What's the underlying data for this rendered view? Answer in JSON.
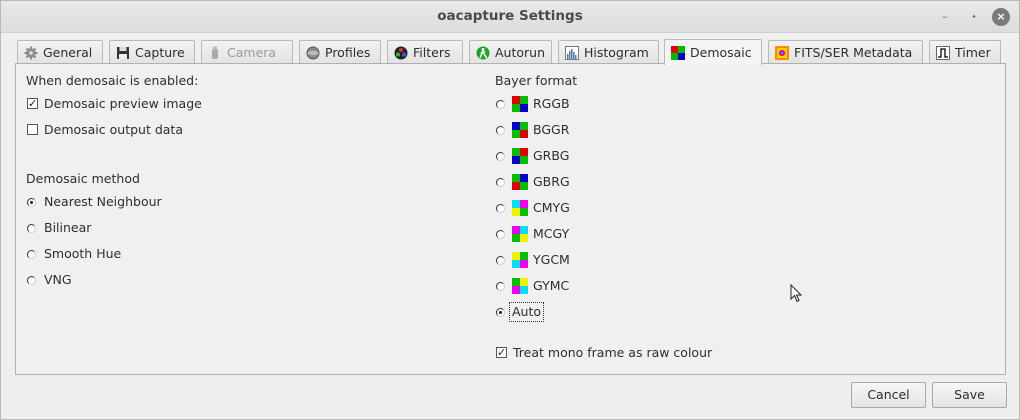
{
  "window": {
    "title": "oacapture Settings",
    "controls": {
      "minimize": "–",
      "maximize": "⬩",
      "close": "×"
    }
  },
  "tabs": [
    {
      "label": "General",
      "icon": "gear-icon"
    },
    {
      "label": "Capture",
      "icon": "floppy-disk-icon"
    },
    {
      "label": "Camera",
      "icon": "camera-icon",
      "disabled": true
    },
    {
      "label": "Profiles",
      "icon": "profiles-icon"
    },
    {
      "label": "Filters",
      "icon": "filter-wheel-icon"
    },
    {
      "label": "Autorun",
      "icon": "autorun-icon"
    },
    {
      "label": "Histogram",
      "icon": "histogram-icon"
    },
    {
      "label": "Demosaic",
      "icon": "demosaic-icon",
      "active": true
    },
    {
      "label": "FITS/SER Metadata",
      "icon": "metadata-icon"
    },
    {
      "label": "Timer",
      "icon": "timer-icon"
    }
  ],
  "demosaic": {
    "enabled_heading": "When demosaic is enabled:",
    "preview_label": "Demosaic preview image",
    "preview_checked": true,
    "output_label": "Demosaic output data",
    "output_checked": false,
    "method_heading": "Demosaic method",
    "methods": [
      {
        "label": "Nearest Neighbour",
        "selected": true
      },
      {
        "label": "Bilinear",
        "selected": false
      },
      {
        "label": "Smooth Hue",
        "selected": false
      },
      {
        "label": "VNG",
        "selected": false
      }
    ]
  },
  "bayer": {
    "heading": "Bayer format",
    "formats": [
      {
        "label": "RGGB",
        "colors": [
          "#e00000",
          "#00c000",
          "#00c000",
          "#0000c8"
        ],
        "selected": false
      },
      {
        "label": "BGGR",
        "colors": [
          "#0000c8",
          "#00c000",
          "#00c000",
          "#e00000"
        ],
        "selected": false
      },
      {
        "label": "GRBG",
        "colors": [
          "#00c000",
          "#e00000",
          "#0000c8",
          "#00c000"
        ],
        "selected": false
      },
      {
        "label": "GBRG",
        "colors": [
          "#00c000",
          "#0000c8",
          "#e00000",
          "#00c000"
        ],
        "selected": false
      },
      {
        "label": "CMYG",
        "colors": [
          "#00e0f0",
          "#f000f0",
          "#f0f000",
          "#00c000"
        ],
        "selected": false
      },
      {
        "label": "MCGY",
        "colors": [
          "#f000f0",
          "#00e0f0",
          "#00c000",
          "#f0f000"
        ],
        "selected": false
      },
      {
        "label": "YGCM",
        "colors": [
          "#f0f000",
          "#00c000",
          "#00e0f0",
          "#f000f0"
        ],
        "selected": false
      },
      {
        "label": "GYMC",
        "colors": [
          "#00c000",
          "#f0f000",
          "#f000f0",
          "#00e0f0"
        ],
        "selected": false
      },
      {
        "label": "Auto",
        "colors": null,
        "selected": true
      }
    ],
    "mono_label": "Treat mono frame as raw colour",
    "mono_checked": true
  },
  "buttons": {
    "cancel": "Cancel",
    "save": "Save"
  }
}
